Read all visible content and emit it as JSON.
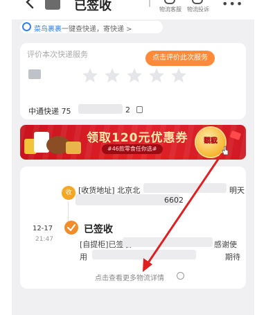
{
  "header": {
    "status_title": "已签收",
    "service_label": "物流客服",
    "complaint_label": "物流投诉",
    "more": "•••"
  },
  "notice": {
    "brand": "菜鸟裹裹",
    "text": "一键查快递，寄快递 >"
  },
  "rating": {
    "label": "评价本次快递服务",
    "button": "点击评价此次服务",
    "stars": 5,
    "tracking_prefix": "中通快递 75",
    "tracking_suffix": "2"
  },
  "banner": {
    "title": "领取120元优惠券",
    "subtitle": "#46款零食任你选#",
    "cta_line1": "戳我",
    "cta_line2": "领取"
  },
  "logistics": {
    "address_badge": "收",
    "address_prefix": "[收货地址] 北京北",
    "address_suffix": "明天",
    "address_number": "6602",
    "date": "12-17",
    "time": "21:47",
    "status": "已签收",
    "desc1_prefix": "[自提柜]已签收",
    "desc1_suffix": "感谢使",
    "desc2_prefix": "用",
    "desc2_suffix": "期待",
    "more_link": "点击查看更多物流详情"
  },
  "colors": {
    "accent_orange": "#ff8a3a",
    "brand_blue": "#2f7ff5",
    "banner_red": "#d01a23",
    "annotation_red": "#e02020"
  }
}
